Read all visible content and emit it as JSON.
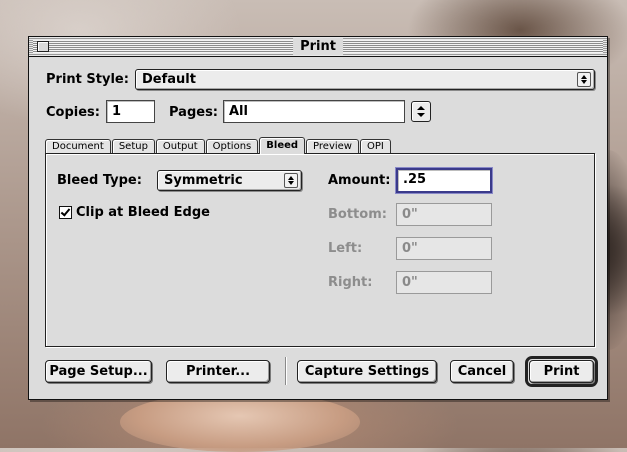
{
  "window": {
    "title": "Print"
  },
  "print_style": {
    "label": "Print Style:",
    "value": "Default"
  },
  "copies": {
    "label": "Copies:",
    "value": "1"
  },
  "pages": {
    "label": "Pages:",
    "value": "All"
  },
  "tabs": [
    {
      "label": "Document",
      "active": false
    },
    {
      "label": "Setup",
      "active": false
    },
    {
      "label": "Output",
      "active": false
    },
    {
      "label": "Options",
      "active": false
    },
    {
      "label": "Bleed",
      "active": true
    },
    {
      "label": "Preview",
      "active": false
    },
    {
      "label": "OPI",
      "active": false
    }
  ],
  "bleed": {
    "type_label": "Bleed Type:",
    "type_value": "Symmetric",
    "clip_label": "Clip at Bleed Edge",
    "clip_checked": true,
    "amount_label": "Amount:",
    "amount_value": ".25",
    "bottom_label": "Bottom:",
    "bottom_value": "0\"",
    "left_label": "Left:",
    "left_value": "0\"",
    "right_label": "Right:",
    "right_value": "0\""
  },
  "buttons": {
    "page_setup": "Page Setup...",
    "printer": "Printer...",
    "capture_settings": "Capture Settings",
    "cancel": "Cancel",
    "print": "Print"
  }
}
